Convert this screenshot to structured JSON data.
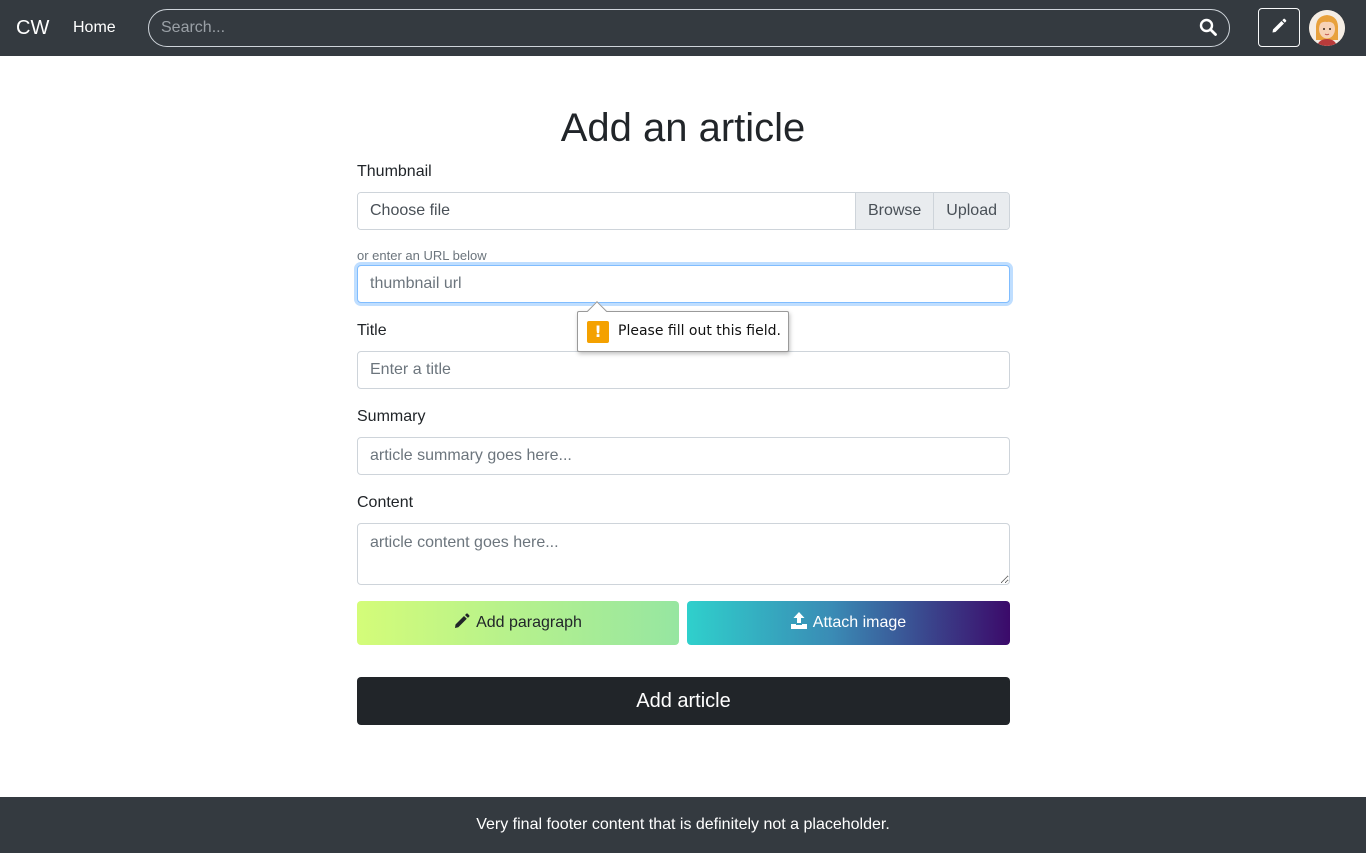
{
  "navbar": {
    "brand": "CW",
    "home_link": "Home",
    "search_placeholder": "Search..."
  },
  "form": {
    "title": "Add an article",
    "thumbnail": {
      "label": "Thumbnail",
      "file_text": "Choose file",
      "browse_label": "Browse",
      "upload_label": "Upload",
      "url_hint": "or enter an URL below",
      "url_placeholder": "thumbnail url"
    },
    "validation_message": "Please fill out this field.",
    "title_field": {
      "label": "Title",
      "placeholder": "Enter a title"
    },
    "summary_field": {
      "label": "Summary",
      "placeholder": "article summary goes here..."
    },
    "content_field": {
      "label": "Content",
      "placeholder": "article content goes here..."
    },
    "add_paragraph_label": "Add paragraph",
    "attach_image_label": "Attach image",
    "submit_label": "Add article"
  },
  "footer": {
    "text": "Very final footer content that is definitely not a placeholder."
  },
  "colors": {
    "navbar_bg": "#343a40",
    "submit_bg": "#212529",
    "focus_border": "#80bdff",
    "warning": "#f4a100"
  },
  "icons": {
    "search": "search-icon",
    "edit": "pencil-icon",
    "avatar": "user-avatar",
    "warning": "exclamation-icon",
    "add_paragraph": "pencil-icon",
    "attach": "upload-icon"
  }
}
